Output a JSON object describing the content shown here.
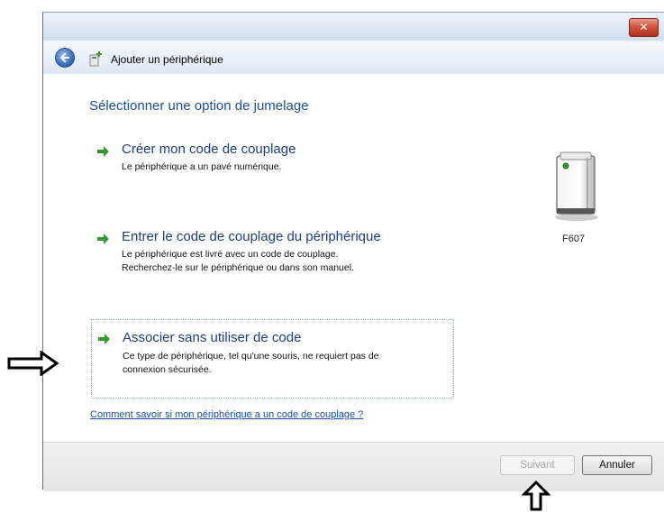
{
  "window": {
    "close_label": "✕"
  },
  "header": {
    "title": "Ajouter un périphérique"
  },
  "main": {
    "page_title": "Sélectionner une option de jumelage",
    "options": [
      {
        "title": "Créer mon code de couplage",
        "desc": [
          "Le périphérique a un pavé numérique."
        ]
      },
      {
        "title": "Entrer le code de couplage du périphérique",
        "desc": [
          "Le périphérique est livré avec un code de couplage.",
          "Recherchez-le sur le périphérique ou dans son manuel."
        ]
      },
      {
        "title": "Associer sans utiliser de code",
        "desc": [
          "Ce type de périphérique, tel qu'une souris, ne requiert pas de",
          "connexion sécurisée."
        ]
      }
    ],
    "device_label": "F607",
    "help_link": "Comment savoir si mon périphérique a un code de couplage ?"
  },
  "footer": {
    "next_label": "Suivant",
    "cancel_label": "Annuler"
  },
  "colors": {
    "accent": "#1e4f8f",
    "link": "#1a4ea8",
    "arrow_green": "#2f9e2f",
    "close_red": "#c8432c"
  }
}
